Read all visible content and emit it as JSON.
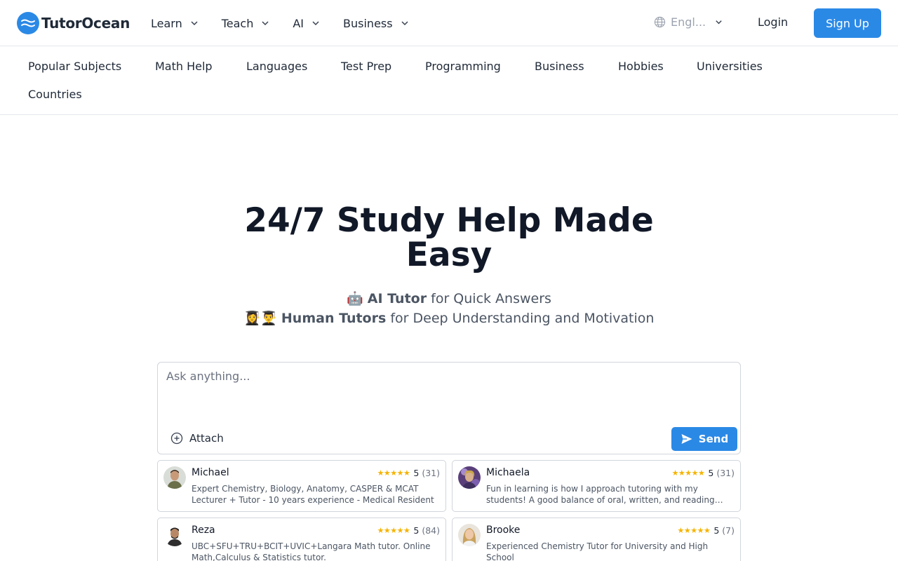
{
  "header": {
    "logo_text": "TutorOcean",
    "nav": [
      {
        "label": "Learn"
      },
      {
        "label": "Teach"
      },
      {
        "label": "AI"
      },
      {
        "label": "Business"
      }
    ],
    "language": "Engl...",
    "login": "Login",
    "signup": "Sign Up",
    "brand_color": "#2b89e6"
  },
  "subjects": [
    "Popular Subjects",
    "Math Help",
    "Languages",
    "Test Prep",
    "Programming",
    "Business",
    "Hobbies",
    "Universities",
    "Countries"
  ],
  "hero": {
    "title": "24/7 Study Help Made Easy",
    "line1": {
      "emoji": "🤖",
      "bold": "AI Tutor",
      "rest": "for Quick Answers"
    },
    "line2": {
      "emoji": "👩‍🎓👨‍🎓",
      "bold": "Human Tutors",
      "rest": "for Deep Understanding and Motivation"
    }
  },
  "ask": {
    "placeholder": "Ask anything...",
    "attach": "Attach",
    "send": "Send"
  },
  "tutors": [
    {
      "name": "Michael",
      "stars": "★★★★★",
      "rating": "5",
      "count": "(31)",
      "desc": "Expert Chemistry, Biology, Anatomy, CASPER & MCAT Lecturer + Tutor - 10 years experience - Medical Resident"
    },
    {
      "name": "Michaela",
      "stars": "★★★★★",
      "rating": "5",
      "count": "(31)",
      "desc": "Fun in learning is how I approach tutoring with my students! A good balance of oral, written, and reading…"
    },
    {
      "name": "Reza",
      "stars": "★★★★★",
      "rating": "5",
      "count": "(84)",
      "desc": "UBC+SFU+TRU+BCIT+UVIC+Langara Math tutor. Online Math,Calculus & Statistics tutor."
    },
    {
      "name": "Brooke",
      "stars": "★★★★★",
      "rating": "5",
      "count": "(7)",
      "desc": "Experienced Chemistry Tutor for University and High School"
    }
  ]
}
